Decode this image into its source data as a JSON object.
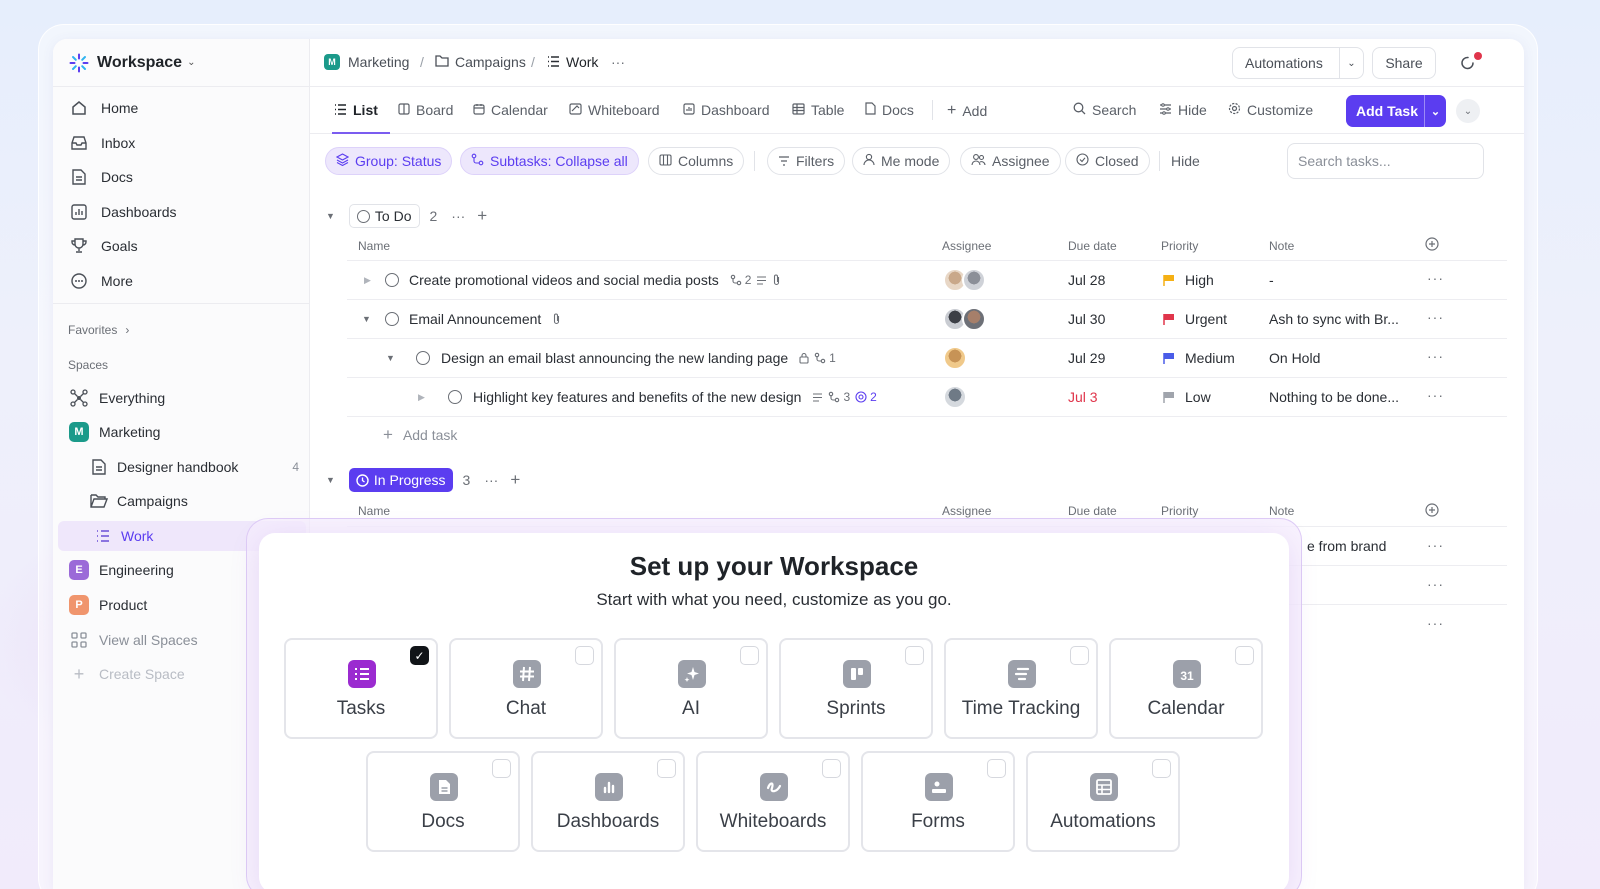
{
  "workspace": {
    "name": "Workspace"
  },
  "sidebar": {
    "nav": [
      {
        "label": "Home",
        "icon": "home-icon"
      },
      {
        "label": "Inbox",
        "icon": "inbox-icon"
      },
      {
        "label": "Docs",
        "icon": "doc-icon"
      },
      {
        "label": "Dashboards",
        "icon": "dashboard-icon"
      },
      {
        "label": "Goals",
        "icon": "trophy-icon"
      },
      {
        "label": "More",
        "icon": "more-icon"
      }
    ],
    "favorites_label": "Favorites",
    "spaces_label": "Spaces",
    "everything": "Everything",
    "marketing": {
      "label": "Marketing",
      "badge": "M",
      "color": "#1b9a8a"
    },
    "designer_handbook": {
      "label": "Designer handbook",
      "count": "4"
    },
    "campaigns": "Campaigns",
    "work": "Work",
    "engineering": {
      "label": "Engineering",
      "badge": "E",
      "color": "#9b6ad8"
    },
    "product": {
      "label": "Product",
      "badge": "P",
      "color": "#f0956d"
    },
    "view_all_spaces": "View all Spaces",
    "create_space": "Create Space"
  },
  "breadcrumb": {
    "space": "Marketing",
    "space_badge": "M",
    "folder": "Campaigns",
    "list": "Work",
    "sep": "/",
    "more": "···"
  },
  "header": {
    "automations": "Automations",
    "share": "Share"
  },
  "views": {
    "tabs": [
      "List",
      "Board",
      "Calendar",
      "Whiteboard",
      "Dashboard",
      "Table",
      "Docs"
    ],
    "add": "Add",
    "search": "Search",
    "hide": "Hide",
    "customize": "Customize",
    "add_task": "Add Task"
  },
  "filters": {
    "group": "Group: Status",
    "subtasks": "Subtasks: Collapse all",
    "columns": "Columns",
    "filters": "Filters",
    "me_mode": "Me mode",
    "assignee": "Assignee",
    "closed": "Closed",
    "hide": "Hide",
    "search_placeholder": "Search tasks..."
  },
  "columns": {
    "name": "Name",
    "assignee": "Assignee",
    "due": "Due date",
    "priority": "Priority",
    "note": "Note"
  },
  "groups": {
    "todo": {
      "label": "To Do",
      "count": "2"
    },
    "inprogress": {
      "label": "In Progress",
      "count": "3"
    }
  },
  "tasks": [
    {
      "name": "Create promotional videos and social media posts",
      "subtasks": "2",
      "due": "Jul 28",
      "priority": "High",
      "priority_color": "#f5b014",
      "note": "-"
    },
    {
      "name": "Email Announcement",
      "due": "Jul 30",
      "priority": "Urgent",
      "priority_color": "#e0354b",
      "note": "Ash to sync with Br..."
    },
    {
      "name": "Design an email blast announcing the new landing page",
      "subtasks": "1",
      "due": "Jul 29",
      "priority": "Medium",
      "priority_color": "#4a5ce8",
      "note": "On Hold"
    },
    {
      "name": "Highlight key features and benefits of the new design",
      "subtasks": "3",
      "mentions": "2",
      "due": "Jul 3",
      "due_color": "#e0354b",
      "priority": "Low",
      "priority_color": "#a0a4ac",
      "note": "Nothing to be done..."
    }
  ],
  "add_task_row": "Add task",
  "inprogress_note_fragment": "e from brand",
  "modal": {
    "title": "Set up your Workspace",
    "subtitle": "Start with what you need, customize as you go.",
    "options_row1": [
      {
        "label": "Tasks",
        "checked": true,
        "icon": "tasks-icon",
        "color": "#9b2bd0"
      },
      {
        "label": "Chat",
        "checked": false,
        "icon": "hashtag-icon",
        "color": "#9ca0aa"
      },
      {
        "label": "AI",
        "checked": false,
        "icon": "sparkle-icon",
        "color": "#9ca0aa"
      },
      {
        "label": "Sprints",
        "checked": false,
        "icon": "sprints-icon",
        "color": "#9ca0aa"
      },
      {
        "label": "Time Tracking",
        "checked": false,
        "icon": "time-tracking-icon",
        "color": "#9ca0aa"
      },
      {
        "label": "Calendar",
        "checked": false,
        "icon": "calendar-icon",
        "color": "#9ca0aa",
        "icon_text": "31"
      }
    ],
    "options_row2": [
      {
        "label": "Docs",
        "checked": false,
        "icon": "doc-icon"
      },
      {
        "label": "Dashboards",
        "checked": false,
        "icon": "dashboard-icon"
      },
      {
        "label": "Whiteboards",
        "checked": false,
        "icon": "whiteboard-icon"
      },
      {
        "label": "Forms",
        "checked": false,
        "icon": "form-icon"
      },
      {
        "label": "Automations",
        "checked": false,
        "icon": "automation-icon"
      }
    ]
  }
}
